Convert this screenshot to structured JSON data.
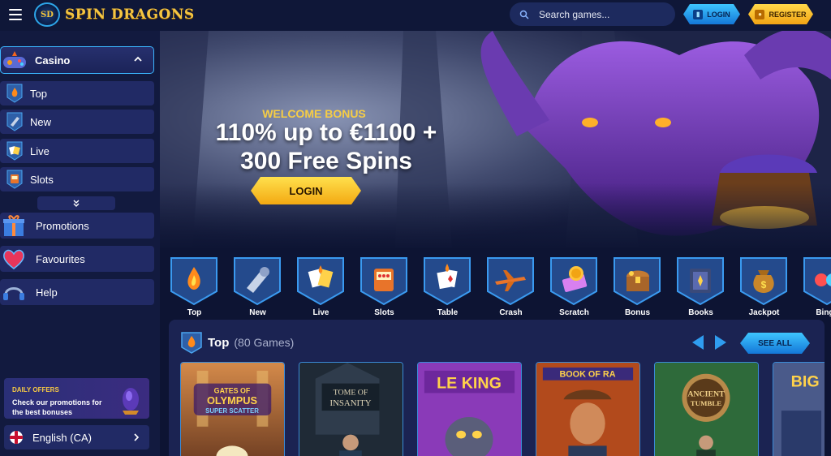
{
  "header": {
    "logo_badge": "SD",
    "logo_text": "SPIN DRAGONS",
    "search_placeholder": "Search games...",
    "login_label": "LOGIN",
    "register_label": "REGISTER"
  },
  "sidebar": {
    "casino_label": "Casino",
    "sub_items": [
      {
        "label": "Top",
        "icon": "flame-icon"
      },
      {
        "label": "New",
        "icon": "horn-icon"
      },
      {
        "label": "Live",
        "icon": "cards-icon"
      },
      {
        "label": "Slots",
        "icon": "slot-machine-icon"
      }
    ],
    "main_items": [
      {
        "label": "Promotions",
        "icon": "gift-icon"
      },
      {
        "label": "Favourites",
        "icon": "heart-icon"
      },
      {
        "label": "Help",
        "icon": "headset-icon"
      }
    ],
    "daily_offers": {
      "title": "DAILY OFFERS",
      "text": "Check our promotions for the best bonuses"
    },
    "language": "English (CA)"
  },
  "hero": {
    "subtitle": "WELCOME BONUS",
    "title_line1": "110% up to €1100 +",
    "title_line2": "300 Free Spins",
    "cta": "LOGIN"
  },
  "categories": [
    {
      "label": "Top",
      "icon": "flame-icon"
    },
    {
      "label": "New",
      "icon": "horn-icon"
    },
    {
      "label": "Live",
      "icon": "cards-icon"
    },
    {
      "label": "Slots",
      "icon": "slot-machine-icon"
    },
    {
      "label": "Table",
      "icon": "poker-cards-icon"
    },
    {
      "label": "Crash",
      "icon": "plane-icon"
    },
    {
      "label": "Scratch",
      "icon": "scratch-card-icon"
    },
    {
      "label": "Bonus",
      "icon": "treasure-chest-icon"
    },
    {
      "label": "Books",
      "icon": "book-icon"
    },
    {
      "label": "Jackpot",
      "icon": "money-bag-icon"
    },
    {
      "label": "Bingo",
      "icon": "bingo-icon"
    }
  ],
  "games_panel": {
    "title": "Top",
    "count": "(80 Games)",
    "see_all": "SEE ALL",
    "games": [
      {
        "title_line1": "GATES OF",
        "title_line2": "OLYMPUS",
        "title_line3": "SUPER SCATTER"
      },
      {
        "title_line1": "TOME OF",
        "title_line2": "INSANITY",
        "title_line3": ""
      },
      {
        "title_line1": "LE KING",
        "title_line2": "",
        "title_line3": ""
      },
      {
        "title_line1": "BOOK OF RA",
        "title_line2": "",
        "title_line3": ""
      },
      {
        "title_line1": "ANCIENT",
        "title_line2": "TUMBLE",
        "title_line3": ""
      },
      {
        "title_line1": "BIG",
        "title_line2": "",
        "title_line3": ""
      }
    ]
  },
  "colors": {
    "background": "#0d1433",
    "sidebar_item": "#212a65",
    "accent_gold": "#f4c542",
    "accent_blue": "#2da5e8"
  }
}
